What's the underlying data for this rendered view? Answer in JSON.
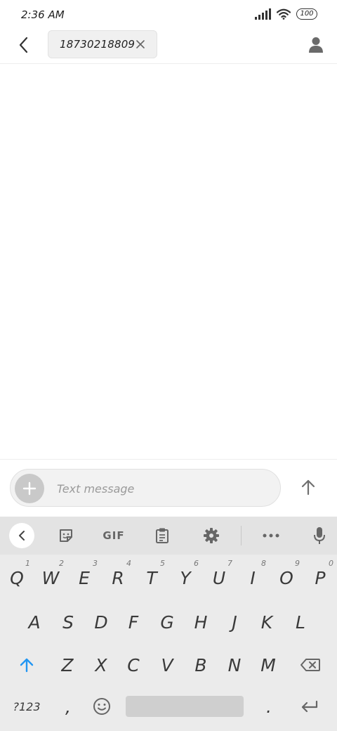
{
  "status_bar": {
    "time": "2:36 AM",
    "battery": "100",
    "icons": [
      "signal-icon",
      "wifi-icon",
      "battery-icon"
    ]
  },
  "header": {
    "back_icon": "back-arrow-icon",
    "recipient": "18730218809",
    "remove_icon": "close-icon",
    "contact_icon": "person-icon"
  },
  "compose": {
    "placeholder": "Text message",
    "value": "",
    "add_icon": "plus-icon",
    "send_icon": "up-arrow-icon"
  },
  "keyboard": {
    "toolbar": {
      "collapse_icon": "chevron-left-icon",
      "sticker_icon": "sticker-icon",
      "gif_label": "GIF",
      "clipboard_icon": "clipboard-icon",
      "settings_icon": "gear-icon",
      "more_icon": "more-icon",
      "mic_icon": "microphone-icon"
    },
    "row1": [
      {
        "label": "Q",
        "hint": "1"
      },
      {
        "label": "W",
        "hint": "2"
      },
      {
        "label": "E",
        "hint": "3"
      },
      {
        "label": "R",
        "hint": "4"
      },
      {
        "label": "T",
        "hint": "5"
      },
      {
        "label": "Y",
        "hint": "6"
      },
      {
        "label": "U",
        "hint": "7"
      },
      {
        "label": "I",
        "hint": "8"
      },
      {
        "label": "O",
        "hint": "9"
      },
      {
        "label": "P",
        "hint": "0"
      }
    ],
    "row2": [
      "A",
      "S",
      "D",
      "F",
      "G",
      "H",
      "J",
      "K",
      "L"
    ],
    "row3": [
      "Z",
      "X",
      "C",
      "V",
      "B",
      "N",
      "M"
    ],
    "row4": {
      "symbols": "?123",
      "comma": ",",
      "emoji_icon": "emoji-icon",
      "period": ".",
      "enter_icon": "enter-icon",
      "shift_icon": "shift-icon",
      "backspace_icon": "backspace-icon"
    }
  },
  "colors": {
    "accent": "#2196f3",
    "keyboard_bg": "#ebebeb",
    "toolbar_bg": "#e3e3e3",
    "compose_bg": "#f2f2f2"
  }
}
